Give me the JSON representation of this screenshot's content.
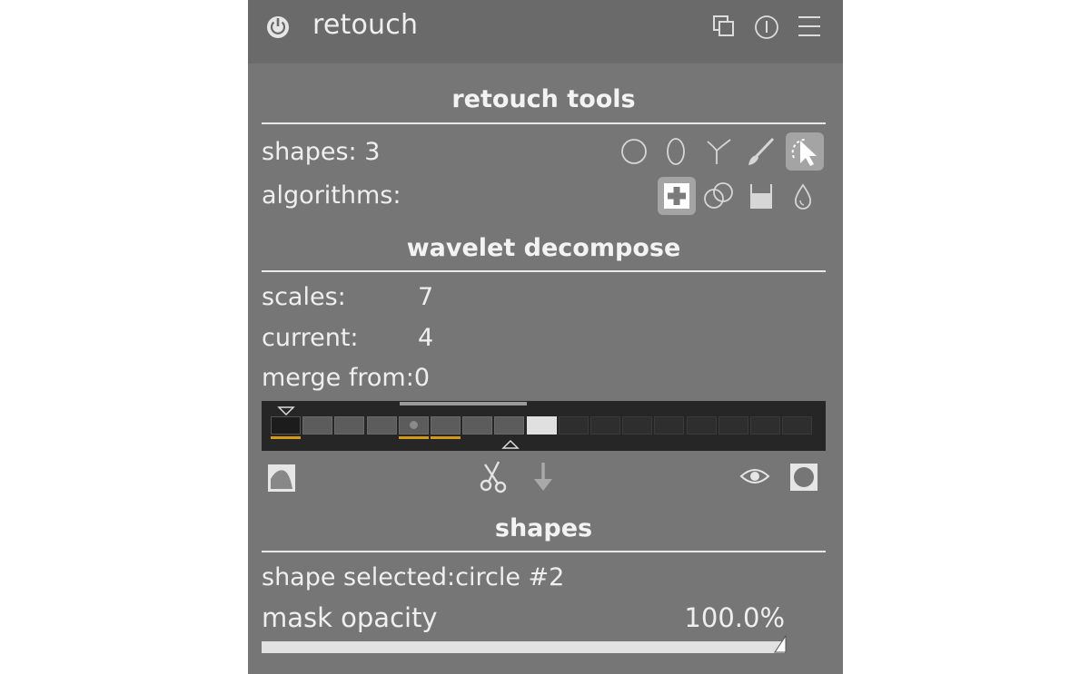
{
  "header": {
    "title": "retouch",
    "icons": [
      "power-icon",
      "multi-instance-icon",
      "reset-icon",
      "presets-icon"
    ]
  },
  "retouch_tools": {
    "title": "retouch tools",
    "shapes_label": "shapes: 3",
    "shape_icons": [
      "circle-icon",
      "ellipse-icon",
      "path-icon",
      "brush-icon",
      "show-hide-shapes-icon"
    ],
    "algorithms_label": "algorithms:",
    "algorithm_icons": [
      "heal-icon",
      "clone-icon",
      "fill-icon",
      "blur-icon"
    ],
    "active_shape_tool": "show-hide-shapes-icon",
    "active_algorithm": "heal-icon"
  },
  "wavelet": {
    "title": "wavelet decompose",
    "scales_label": "scales:",
    "scales_value": "7",
    "current_label": "current:",
    "current_value": "4",
    "merge_label": "merge from:",
    "merge_value": "0",
    "bar": {
      "total_cells": 17,
      "scales": 7,
      "current": 4,
      "merge_from": 0
    },
    "action_icons": [
      "display-wavelet-scale-icon",
      "cut-icon",
      "paste-icon",
      "display-masks-icon",
      "mask-preview-icon"
    ]
  },
  "shapes": {
    "title": "shapes",
    "selected_label": "shape selected:",
    "selected_value": "circle #2",
    "opacity_label": "mask opacity",
    "opacity_value": "100.0%",
    "opacity_fraction": 1.0
  },
  "colors": {
    "panel": "#767676",
    "header": "#6a6a6a",
    "accent": "#d69a1a",
    "bar_background": "#262626"
  }
}
